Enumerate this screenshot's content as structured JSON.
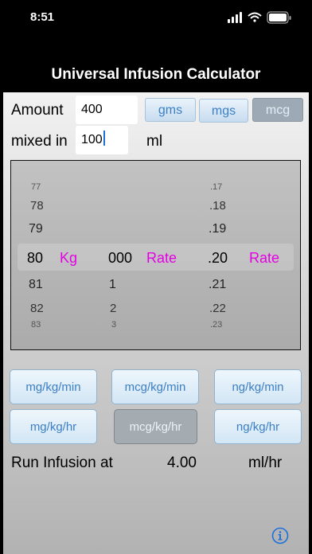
{
  "status_bar": {
    "time": "8:51"
  },
  "app": {
    "title": "Universal Infusion Calculator"
  },
  "form": {
    "amount_label": "Amount",
    "amount_value": "400",
    "mixed_label": "mixed in",
    "mixed_value": "100",
    "volume_unit": "ml",
    "unit_buttons": [
      {
        "label": "gms",
        "enabled": true
      },
      {
        "label": "mgs",
        "enabled": true
      },
      {
        "label": "mcg",
        "enabled": false
      }
    ]
  },
  "picker": {
    "weight": {
      "values": [
        "77",
        "78",
        "79",
        "80",
        "81",
        "82",
        "83"
      ],
      "selected": "80",
      "unit": "Kg"
    },
    "rate_whole": {
      "values": [
        "",
        "",
        "",
        "000",
        "1",
        "2",
        "3"
      ],
      "selected": "000",
      "unit": "Rate"
    },
    "rate_decimal": {
      "values": [
        ".17",
        ".18",
        ".19",
        ".20",
        ".21",
        ".22",
        ".23"
      ],
      "selected": ".20",
      "unit": "Rate"
    }
  },
  "dose_units": [
    {
      "label": "mg/kg/min",
      "enabled": true
    },
    {
      "label": "mcg/kg/min",
      "enabled": true
    },
    {
      "label": "ng/kg/min",
      "enabled": true
    },
    {
      "label": "mg/kg/hr",
      "enabled": true
    },
    {
      "label": "mcg/kg/hr",
      "enabled": false
    },
    {
      "label": "ng/kg/hr",
      "enabled": true
    }
  ],
  "result": {
    "label": "Run Infusion at",
    "value": "4.00",
    "unit": "ml/hr"
  },
  "icons": {
    "info": "info-icon",
    "signal": "signal-icon",
    "wifi": "wifi-icon",
    "battery": "battery-icon"
  },
  "colors": {
    "accent_text": "#3b7fc4",
    "picker_unit": "#e300e3"
  }
}
